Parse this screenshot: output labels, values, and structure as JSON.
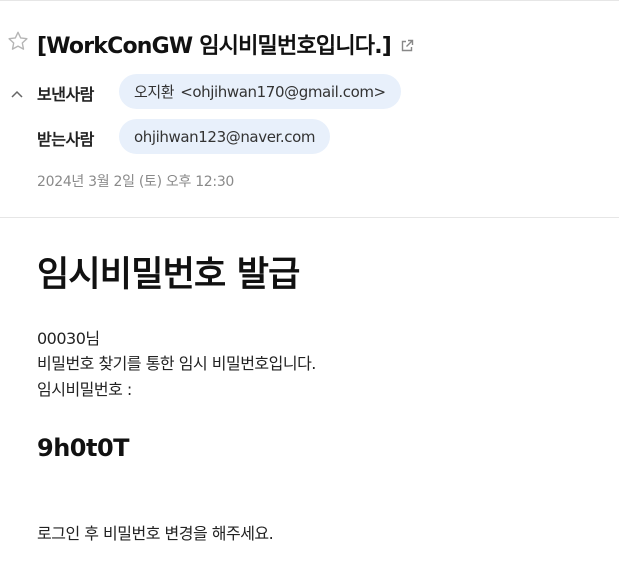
{
  "email": {
    "subject": "[WorkConGW 임시비밀번호입니다.]",
    "sender_label": "보낸사람",
    "sender_name": "오지환",
    "sender_email": "<ohjihwan170@gmail.com>",
    "recipient_label": "받는사람",
    "recipient_email": "ohjihwan123@naver.com",
    "date": "2024년 3월 2일 (토) 오후 12:30",
    "icons": {
      "star": "star-icon",
      "popout": "popout-icon",
      "collapse": "chevron-up-icon"
    }
  },
  "body": {
    "title": "임시비밀번호 발급",
    "greeting": "00030님",
    "line1": "비밀번호 찾기를 통한 임시 비밀번호입니다.",
    "line2": "임시비밀번호 :",
    "temp_password": "9h0t0T",
    "footer": "로그인 후 비밀번호 변경을 해주세요."
  }
}
